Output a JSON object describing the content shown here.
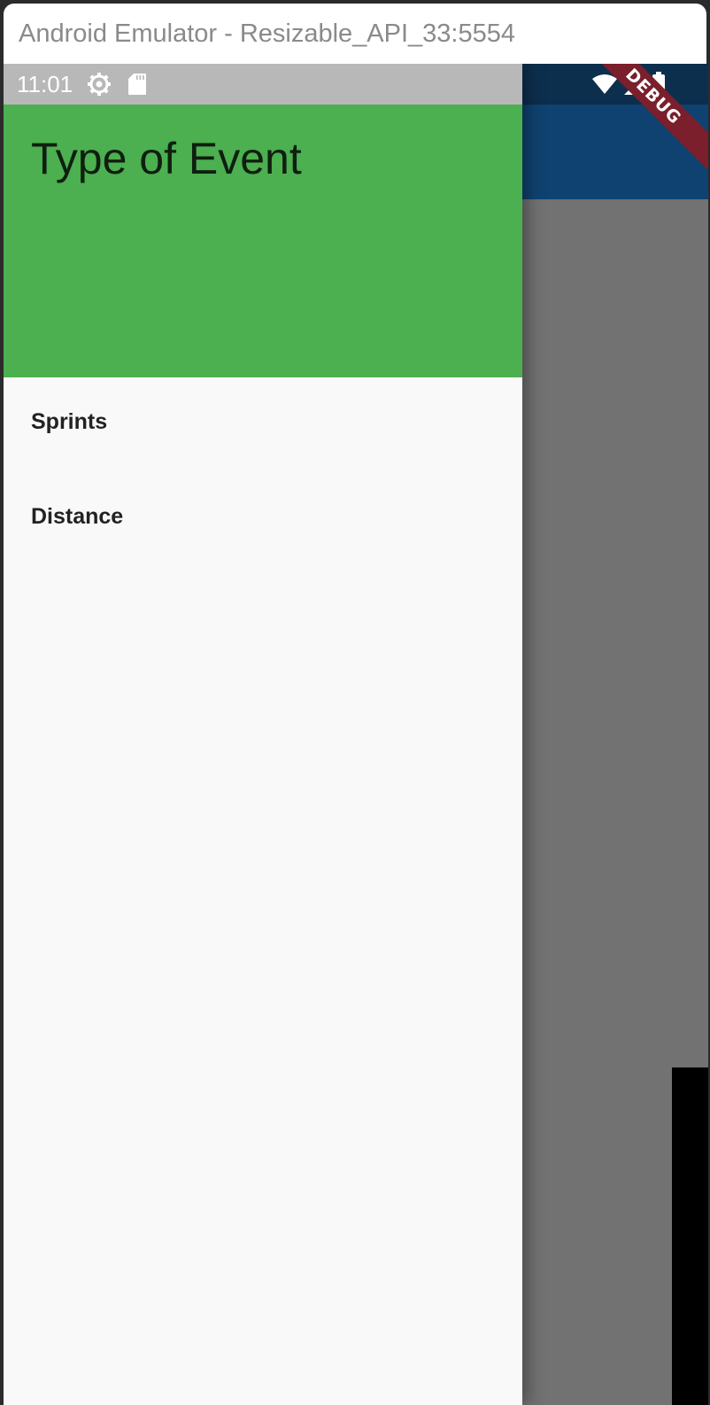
{
  "window": {
    "title": "Android Emulator - Resizable_API_33:5554"
  },
  "status_bar": {
    "time": "11:01",
    "icons_left": [
      "settings-icon",
      "sd-card-icon"
    ],
    "icons_right": [
      "wifi-icon",
      "signal-icon",
      "battery-icon"
    ]
  },
  "debug_banner": {
    "label": "DEBUG"
  },
  "drawer": {
    "header_title": "Type of Event",
    "header_color": "#4caf50",
    "items": [
      {
        "label": "Sprints"
      },
      {
        "label": "Distance"
      }
    ]
  },
  "colors": {
    "app_bar": "#0f4270",
    "scrim": "#767676",
    "debug_banner": "#7a1f2b"
  }
}
